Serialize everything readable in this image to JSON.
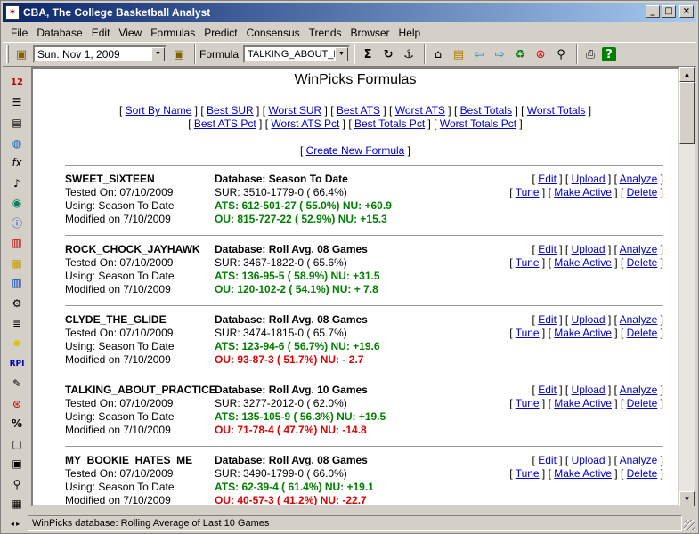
{
  "window": {
    "title": "CBA,  The College Basketball Analyst"
  },
  "menu": [
    "File",
    "Database",
    "Edit",
    "View",
    "Formulas",
    "Predict",
    "Consensus",
    "Trends",
    "Browser",
    "Help"
  ],
  "toolbar": {
    "date": "Sun. Nov  1, 2009",
    "formula_label": "Formula",
    "formula_value": "TALKING_ABOUT_PR"
  },
  "page": {
    "title": "WinPicks Formulas",
    "sort_links": [
      "Sort By Name",
      "Best SUR",
      "Worst SUR",
      "Best ATS",
      "Worst ATS",
      "Best Totals",
      "Worst Totals"
    ],
    "pct_links": [
      "Best ATS Pct",
      "Worst ATS Pct",
      "Best Totals Pct",
      "Worst Totals Pct"
    ],
    "create_link": "Create New Formula"
  },
  "actions": {
    "edit": "Edit",
    "upload": "Upload",
    "analyze": "Analyze",
    "tune": "Tune",
    "make_active": "Make Active",
    "delete": "Delete"
  },
  "formulas": [
    {
      "name": "SWEET_SIXTEEN",
      "tested": "Tested On: 07/10/2009",
      "using": "Using: Season To Date",
      "modified": "Modified on 7/10/2009",
      "database": "Database: Season To Date",
      "sur": "SUR: 3510-1779-0 ( 66.4%)",
      "ats": "ATS: 612-501-27 ( 55.0%) NU: +60.9",
      "ou": "OU: 815-727-22 ( 52.9%) NU: +15.3",
      "ats_color": "green",
      "ou_color": "green"
    },
    {
      "name": "ROCK_CHOCK_JAYHAWK",
      "tested": "Tested On: 07/10/2009",
      "using": "Using: Season To Date",
      "modified": "Modified on 7/10/2009",
      "database": "Database: Roll Avg. 08 Games",
      "sur": "SUR: 3467-1822-0 ( 65.6%)",
      "ats": "ATS: 136-95-5 ( 58.9%) NU: +31.5",
      "ou": "OU: 120-102-2 ( 54.1%) NU: + 7.8",
      "ats_color": "green",
      "ou_color": "green"
    },
    {
      "name": "CLYDE_THE_GLIDE",
      "tested": "Tested On: 07/10/2009",
      "using": "Using: Season To Date",
      "modified": "Modified on 7/10/2009",
      "database": "Database: Roll Avg. 08 Games",
      "sur": "SUR: 3474-1815-0 ( 65.7%)",
      "ats": "ATS: 123-94-6 ( 56.7%) NU: +19.6",
      "ou": "OU: 93-87-3 ( 51.7%) NU: - 2.7",
      "ats_color": "green",
      "ou_color": "red"
    },
    {
      "name": "TALKING_ABOUT_PRACTICE",
      "tested": "Tested On: 07/10/2009",
      "using": "Using: Season To Date",
      "modified": "Modified on 7/10/2009",
      "database": "Database: Roll Avg. 10 Games",
      "sur": "SUR: 3277-2012-0 ( 62.0%)",
      "ats": "ATS: 135-105-9 ( 56.3%) NU: +19.5",
      "ou": "OU: 71-78-4 ( 47.7%) NU: -14.8",
      "ats_color": "green",
      "ou_color": "red"
    },
    {
      "name": "MY_BOOKIE_HATES_ME",
      "tested": "Tested On: 07/10/2009",
      "using": "Using: Season To Date",
      "modified": "Modified on 7/10/2009",
      "database": "Database: Roll Avg. 08 Games",
      "sur": "SUR: 3490-1799-0 ( 66.0%)",
      "ats": "ATS: 62-39-4 ( 61.4%) NU: +19.1",
      "ou": "OU: 40-57-3 ( 41.2%) NU: -22.7",
      "ats_color": "green",
      "ou_color": "red"
    }
  ],
  "status": {
    "text": "WinPicks database:  Rolling Average of Last 10 Games"
  }
}
